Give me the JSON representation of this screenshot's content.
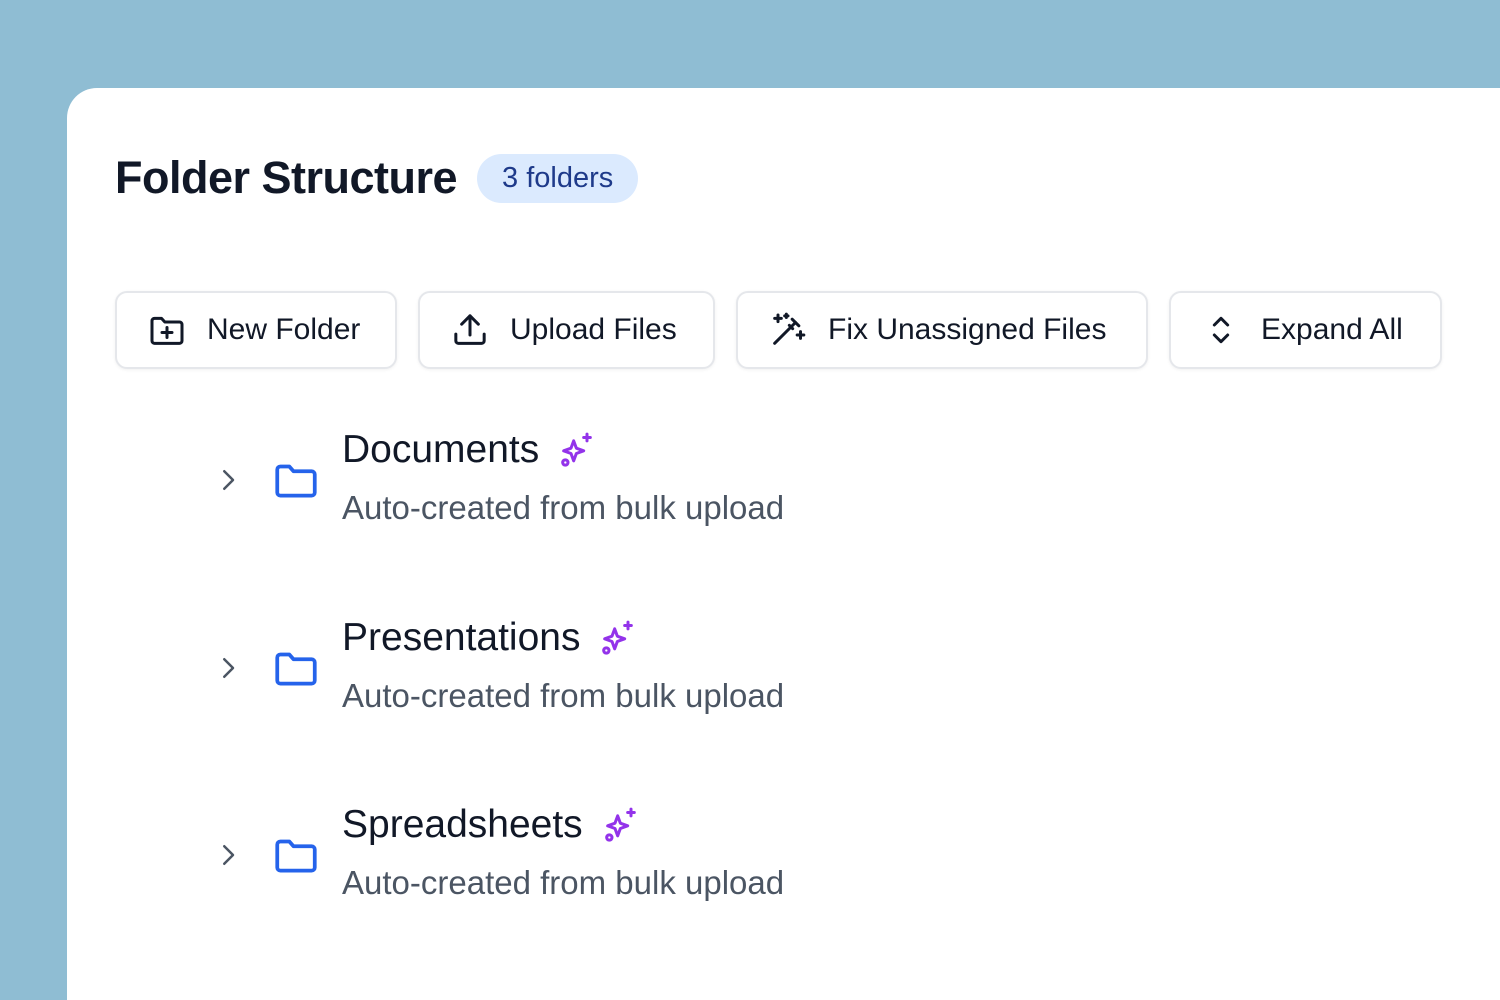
{
  "header": {
    "title": "Folder Structure",
    "badge": "3 folders"
  },
  "toolbar": {
    "new_folder": {
      "label": "New Folder",
      "icon": "folder-plus-icon"
    },
    "upload_files": {
      "label": "Upload Files",
      "icon": "upload-icon"
    },
    "fix_unassigned": {
      "label": "Fix Unassigned Files",
      "icon": "magic-wand-icon"
    },
    "expand_all": {
      "label": "Expand All",
      "icon": "chevrons-up-down-icon"
    }
  },
  "folders": [
    {
      "name": "Documents",
      "description": "Auto-created from bulk upload"
    },
    {
      "name": "Presentations",
      "description": "Auto-created from bulk upload"
    },
    {
      "name": "Spreadsheets",
      "description": "Auto-created from bulk upload"
    }
  ],
  "colors": {
    "background": "#8fbdd3",
    "panel": "#ffffff",
    "badge_bg": "#dbeafe",
    "badge_text": "#1e3a8a",
    "folder_icon": "#2563eb",
    "sparkle_icon": "#9333ea",
    "text_primary": "#111827",
    "text_secondary": "#4b5563"
  }
}
